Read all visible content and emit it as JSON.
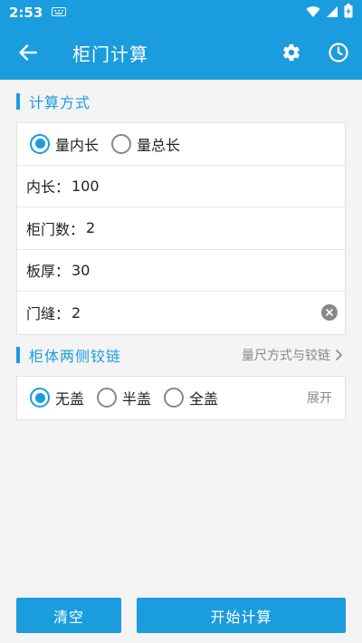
{
  "status": {
    "time": "2:53",
    "keyboard_icon": "keyboard-icon",
    "icons": [
      "wifi-icon",
      "signal-icon",
      "battery-charging-icon"
    ]
  },
  "app_bar": {
    "title": "柜门计算",
    "back_icon": "arrow-left-icon",
    "settings_icon": "gear-icon",
    "history_icon": "clock-icon"
  },
  "section1": {
    "title": "计算方式",
    "options": [
      {
        "label": "量内长",
        "checked": true
      },
      {
        "label": "量总长",
        "checked": false
      }
    ],
    "fields": [
      {
        "label": "内长：",
        "value": "100"
      },
      {
        "label": "柜门数：",
        "value": "2"
      },
      {
        "label": "板厚：",
        "value": "30"
      },
      {
        "label": "门缝：",
        "value": "2"
      }
    ]
  },
  "section2": {
    "title": "柜体两侧铰链",
    "link": "量尺方式与铰链",
    "options": [
      {
        "label": "无盖",
        "checked": true
      },
      {
        "label": "半盖",
        "checked": false
      },
      {
        "label": "全盖",
        "checked": false
      }
    ],
    "expand": "展开"
  },
  "buttons": {
    "clear": "清空",
    "calc": "开始计算"
  },
  "colors": {
    "primary": "#1a9cde",
    "background": "#f4f4f4",
    "muted": "#888888"
  }
}
